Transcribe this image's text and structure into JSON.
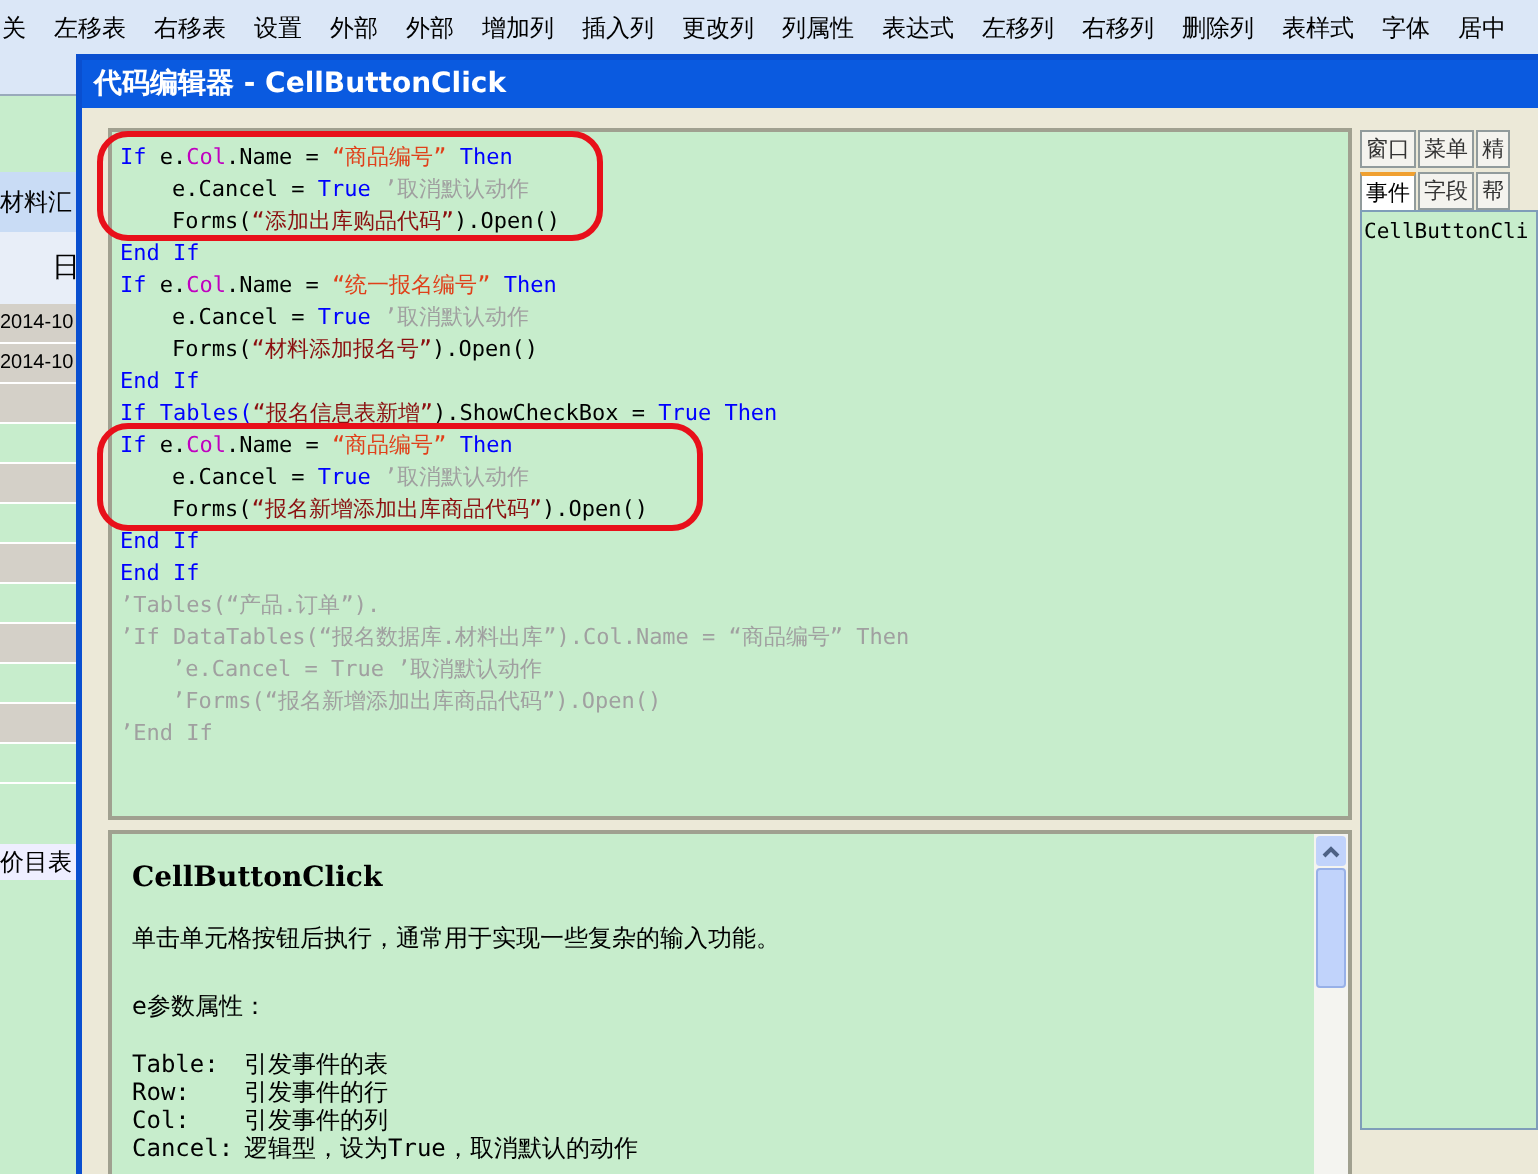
{
  "toolbar": {
    "items": [
      "关",
      "左移表",
      "右移表",
      "设置",
      "外部",
      "外部",
      "增加列",
      "插入列",
      "更改列",
      "列属性",
      "表达式",
      "左移列",
      "右移列",
      "删除列",
      "表样式",
      "字体",
      "居中"
    ]
  },
  "background_table": {
    "tab": "材料汇",
    "header": "日",
    "rows": [
      "2014-10",
      "2014-10"
    ],
    "bottom_tab": "价目表"
  },
  "dialog": {
    "title": "代码编辑器 - CellButtonClick",
    "code_lines": [
      {
        "kind": "top",
        "tokens": [
          {
            "kind": "keyword",
            "text": "If"
          },
          {
            "kind": "plain",
            "text": " e."
          },
          {
            "kind": "member",
            "text": "Col"
          },
          {
            "kind": "plain",
            "text": ".Name = "
          },
          {
            "kind": "string",
            "text": "“商品编号”"
          },
          {
            "kind": "keyword",
            "text": " Then"
          }
        ]
      },
      {
        "kind": "indented",
        "tokens": [
          {
            "kind": "plain",
            "text": "e.Cancel = "
          },
          {
            "kind": "keyword",
            "text": "True"
          },
          {
            "kind": "comment",
            "text": " ’取消默认动作"
          }
        ]
      },
      {
        "kind": "indented",
        "tokens": [
          {
            "kind": "plain",
            "text": "Forms("
          },
          {
            "kind": "literal",
            "text": "“添加出库购品代码”"
          },
          {
            "kind": "plain",
            "text": ").Open()"
          }
        ]
      },
      {
        "kind": "top",
        "tokens": [
          {
            "kind": "keyword",
            "text": "End If"
          }
        ]
      },
      {
        "kind": "top",
        "tokens": [
          {
            "kind": "keyword",
            "text": "If"
          },
          {
            "kind": "plain",
            "text": " e."
          },
          {
            "kind": "member",
            "text": "Col"
          },
          {
            "kind": "plain",
            "text": ".Name = "
          },
          {
            "kind": "string",
            "text": "“统一报名编号”"
          },
          {
            "kind": "keyword",
            "text": " Then"
          }
        ]
      },
      {
        "kind": "indented",
        "tokens": [
          {
            "kind": "plain",
            "text": "e.Cancel = "
          },
          {
            "kind": "keyword",
            "text": "True"
          },
          {
            "kind": "comment",
            "text": " ’取消默认动作"
          }
        ]
      },
      {
        "kind": "indented",
        "tokens": [
          {
            "kind": "plain",
            "text": "Forms("
          },
          {
            "kind": "literal",
            "text": "“材料添加报名号”"
          },
          {
            "kind": "plain",
            "text": ").Open()"
          }
        ]
      },
      {
        "kind": "top",
        "tokens": [
          {
            "kind": "keyword",
            "text": "End If"
          }
        ]
      },
      {
        "kind": "top",
        "tokens": [
          {
            "kind": "keyword",
            "text": "If Tables("
          },
          {
            "kind": "literal",
            "text": "“报名信息表新增”"
          },
          {
            "kind": "plain",
            "text": ").ShowCheckBox = "
          },
          {
            "kind": "keyword",
            "text": "True Then"
          }
        ]
      },
      {
        "kind": "top",
        "tokens": [
          {
            "kind": "keyword",
            "text": "If"
          },
          {
            "kind": "plain",
            "text": " e."
          },
          {
            "kind": "member",
            "text": "Col"
          },
          {
            "kind": "plain",
            "text": ".Name = "
          },
          {
            "kind": "string",
            "text": "“商品编号”"
          },
          {
            "kind": "keyword",
            "text": " Then"
          }
        ]
      },
      {
        "kind": "indented",
        "tokens": [
          {
            "kind": "plain",
            "text": "e.Cancel = "
          },
          {
            "kind": "keyword",
            "text": "True"
          },
          {
            "kind": "comment",
            "text": " ’取消默认动作"
          }
        ]
      },
      {
        "kind": "indented",
        "tokens": [
          {
            "kind": "plain",
            "text": "Forms("
          },
          {
            "kind": "literal",
            "text": "“报名新增添加出库商品代码”"
          },
          {
            "kind": "plain",
            "text": ").Open()"
          }
        ]
      },
      {
        "kind": "top",
        "tokens": [
          {
            "kind": "keyword",
            "text": "End If"
          }
        ]
      },
      {
        "kind": "top",
        "tokens": [
          {
            "kind": "keyword",
            "text": "End If"
          }
        ]
      },
      {
        "kind": "top",
        "tokens": [
          {
            "kind": "comment",
            "text": "’Tables(“产品.订单”)."
          }
        ]
      },
      {
        "kind": "top",
        "tokens": [
          {
            "kind": "comment",
            "text": "’If DataTables(“报名数据库.材料出库”).Col.Name = “商品编号” Then"
          }
        ]
      },
      {
        "kind": "indented",
        "tokens": [
          {
            "kind": "comment",
            "text": "’e.Cancel = True ’取消默认动作"
          }
        ]
      },
      {
        "kind": "indented",
        "tokens": [
          {
            "kind": "comment",
            "text": "’Forms(“报名新增添加出库商品代码”).Open()"
          }
        ]
      },
      {
        "kind": "top",
        "tokens": [
          {
            "kind": "comment",
            "text": "’End If"
          }
        ]
      }
    ],
    "help": {
      "title": "CellButtonClick",
      "description": "单击单元格按钮后执行，通常用于实现一些复杂的输入功能。",
      "section": "e参数属性：",
      "params": [
        {
          "name": "Table:",
          "text": "引发事件的表"
        },
        {
          "name": "Row:",
          "text": "引发事件的行"
        },
        {
          "name": "Col:",
          "text": "引发事件的列"
        },
        {
          "name": "Cancel:",
          "text": "逻辑型，设为True，取消默认的动作"
        }
      ]
    },
    "tabs_top": [
      {
        "label": "窗口",
        "selected": false
      },
      {
        "label": "菜单",
        "selected": false
      },
      {
        "label": "精",
        "selected": false
      }
    ],
    "tabs_bottom": [
      {
        "label": "事件",
        "selected": true
      },
      {
        "label": "字段",
        "selected": false
      },
      {
        "label": "帮",
        "selected": false
      }
    ],
    "events": [
      "CellButtonCli"
    ]
  }
}
